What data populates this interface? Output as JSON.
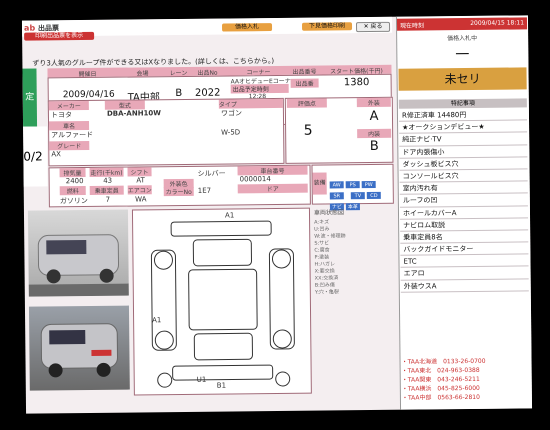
{
  "header": {
    "logo": "ab",
    "title": "出品票",
    "sub_button": "印刷出品票を表示",
    "top_buttons": [
      "価格入札",
      "下見価格印刷",
      "✕ 戻る"
    ],
    "notice": "ずり3人氣のグループ件ができる又はXなりました。(詳しくは、こちらから。)",
    "left_tab": "定",
    "left_date": "0/2"
  },
  "row1": {
    "labels": [
      "開催日",
      "会場",
      "レーン",
      "出品No",
      "コーナー",
      "出品番号",
      "スタート価格(千円)"
    ],
    "date": "2009/04/16",
    "venue": "TA中部",
    "lane": "B",
    "number": "2022",
    "corner": "AAオヒデューEコーナー",
    "corner_sub": "出品予定時刻",
    "corner_time": "12:28",
    "lot_label": "出品番",
    "start_price": "1380"
  },
  "car": {
    "maker_label": "メーカー",
    "maker": "トヨタ",
    "type_label": "型式",
    "type": "DBA-ANH10W",
    "model_label": "車名",
    "model": "アルファード",
    "grade_label": "グレード",
    "grade": "AX",
    "drive_label": "タイプ",
    "drive": "ワゴン",
    "drive_sub": "W-5D",
    "score_label": "評価点",
    "score": "5",
    "exterior_label": "外装",
    "exterior": "A",
    "interior_label": "内装",
    "interior": "B"
  },
  "specs": {
    "labels": [
      "排気量",
      "走行(千km)",
      "シフト",
      "外装色",
      "車台番号"
    ],
    "displacement": "2400",
    "mileage": "43",
    "shift": "AT",
    "color": "シルバー",
    "color_code": "1E7",
    "chassis": "0000014",
    "fuel_label": "燃料",
    "fuel": "ガソリン",
    "seats_label": "乗車定員",
    "seats": "7",
    "ac_label": "エアコン",
    "ac": "WA",
    "color_label": "カラーNo",
    "doors_label": "ドア",
    "equip_label": "装備",
    "equip_chips": [
      "AW",
      "PS",
      "PW",
      "SR",
      "TV",
      "CD",
      "ナビ",
      "本革"
    ]
  },
  "diagram": {
    "title": "車両状態図",
    "markers": [
      "A1",
      "A1",
      "B1",
      "U1"
    ],
    "legend": [
      "A:キズ",
      "U:凹み",
      "W:波・修理跡",
      "S:サビ",
      "C:腐食",
      "P:塗装",
      "H:ハガレ",
      "X:要交換",
      "XX:交換済",
      "B:凹み傷",
      "Y:穴・亀裂"
    ]
  },
  "right": {
    "time_label": "現在時刻",
    "clock": "2009/04/15 18:11",
    "status_label": "価格入札中",
    "dash": "一",
    "unsold": "未セリ",
    "memo_title": "特記事項",
    "items": [
      "R修正済車 14480円",
      "★オークションデビュー★",
      "純正ナビ·TV",
      "ドア内張傷小",
      "ダッシュ板ビス穴",
      "コンソールビス穴",
      "室内汚れ有",
      "ルーフの凹",
      "ホイールカバーA",
      "ナビロム取説",
      "乗車定員8名",
      "バックガイドモニター",
      "ETC",
      "エアロ",
      "外装ウスA"
    ],
    "contacts": [
      {
        "name": "・TAA北海道",
        "tel": "0133-26-0700"
      },
      {
        "name": "・TAA東北",
        "tel": "024-963-0388"
      },
      {
        "name": "・TAA関東",
        "tel": "043-246-5211"
      },
      {
        "name": "・TAA横浜",
        "tel": "045-825-6000"
      },
      {
        "name": "・TAA中部",
        "tel": "0563-66-2810"
      }
    ]
  },
  "colors": {
    "pink": "#e8a8b8",
    "orange": "#d9a040",
    "screen": "#f4eef0",
    "blue_chip": "#3b6fc6"
  }
}
